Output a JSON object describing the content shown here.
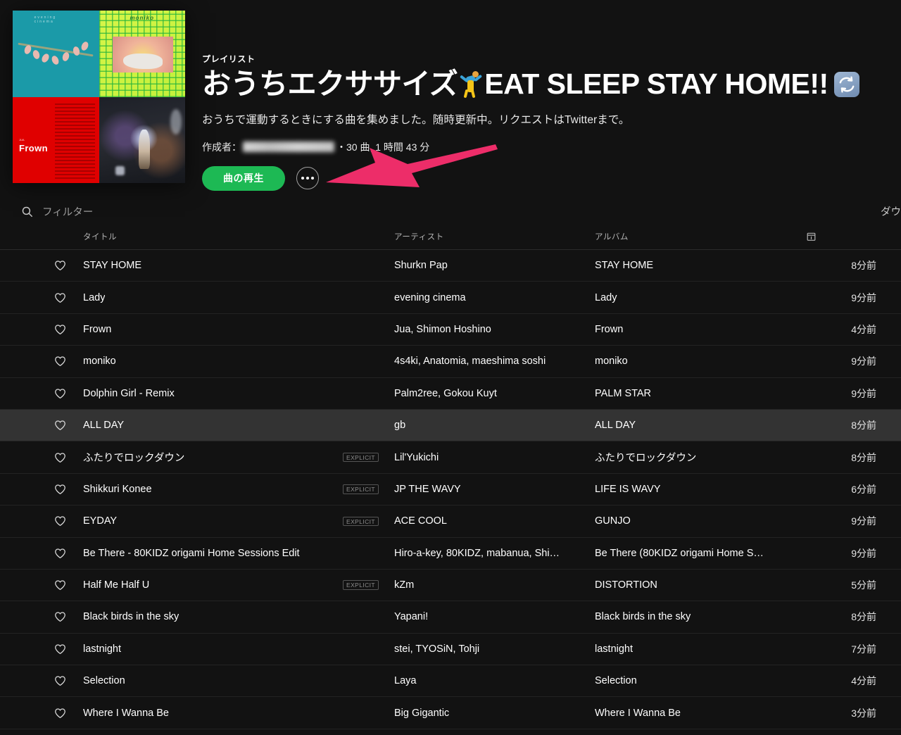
{
  "playlist": {
    "kind_label": "プレイリスト",
    "title_part1": "おうちエクササイズ",
    "title_emoji1": "cartwheel-emoji",
    "title_part2": "EAT SLEEP STAY HOME!!",
    "title_emoji2": "refresh-emoji",
    "title_full": "おうちエクササイズ🤸EAT SLEEP STAY HOME!!🔄",
    "description": "おうちで運動するときにする曲を集めました。随時更新中。リクエストはTwitterまで。",
    "creator_label": "作成者：",
    "creator_name_redacted": "",
    "stats": "・30 曲, 1 時間 43 分",
    "track_count": "30 曲",
    "duration": "1 時間 43 分"
  },
  "actions": {
    "play_label": "曲の再生",
    "more_label": "…",
    "more_icon": "ellipsis-icon"
  },
  "filter": {
    "icon": "search-icon",
    "placeholder": "フィルター",
    "value": ""
  },
  "download": {
    "label": "ダウ"
  },
  "columns": {
    "heart": "",
    "title": "タイトル",
    "artist": "アーティスト",
    "album": "アルバム",
    "date_icon": "calendar-icon"
  },
  "colors": {
    "background": "#121212",
    "accent_green": "#1db954",
    "annotation_pink": "#ED2D69",
    "row_active": "#333333",
    "muted_text": "#b3b3b3"
  },
  "annotation": {
    "type": "arrow",
    "direction": "left",
    "points_at": "more-options-button",
    "color": "#ED2D69"
  },
  "tracks": [
    {
      "heart": "heart-outline-icon",
      "title": "STAY HOME",
      "explicit": false,
      "artist": "Shurkn Pap",
      "album": "STAY HOME",
      "date": "8分前",
      "active": false
    },
    {
      "heart": "heart-outline-icon",
      "title": "Lady",
      "explicit": false,
      "artist": "evening cinema",
      "album": "Lady",
      "date": "9分前",
      "active": false
    },
    {
      "heart": "heart-outline-icon",
      "title": "Frown",
      "explicit": false,
      "artist": "Jua, Shimon Hoshino",
      "album": "Frown",
      "date": "4分前",
      "active": false
    },
    {
      "heart": "heart-outline-icon",
      "title": "moniko",
      "explicit": false,
      "artist": "4s4ki, Anatomia, maeshima soshi",
      "album": "moniko",
      "date": "9分前",
      "active": false
    },
    {
      "heart": "heart-outline-icon",
      "title": "Dolphin Girl - Remix",
      "explicit": false,
      "artist": "Palm2ree, Gokou Kuyt",
      "album": "PALM STAR",
      "date": "9分前",
      "active": false
    },
    {
      "heart": "heart-outline-icon",
      "title": "ALL DAY",
      "explicit": false,
      "artist": "gb",
      "album": "ALL DAY",
      "date": "8分前",
      "active": true
    },
    {
      "heart": "heart-outline-icon",
      "title": "ふたりでロックダウン",
      "explicit": true,
      "artist": "Lil'Yukichi",
      "album": "ふたりでロックダウン",
      "date": "8分前",
      "active": false
    },
    {
      "heart": "heart-outline-icon",
      "title": "Shikkuri Konee",
      "explicit": true,
      "artist": "JP THE WAVY",
      "album": "LIFE IS WAVY",
      "date": "6分前",
      "active": false
    },
    {
      "heart": "heart-outline-icon",
      "title": "EYDAY",
      "explicit": true,
      "artist": "ACE COOL",
      "album": "GUNJO",
      "date": "9分前",
      "active": false
    },
    {
      "heart": "heart-outline-icon",
      "title": "Be There - 80KIDZ origami Home Sessions Edit",
      "explicit": false,
      "artist": "Hiro-a-key, 80KIDZ, mabanua, Shi…",
      "album": "Be There (80KIDZ origami Home S…",
      "date": "9分前",
      "active": false
    },
    {
      "heart": "heart-outline-icon",
      "title": "Half Me Half U",
      "explicit": true,
      "artist": "kZm",
      "album": "DISTORTION",
      "date": "5分前",
      "active": false
    },
    {
      "heart": "heart-outline-icon",
      "title": "Black birds in the sky",
      "explicit": false,
      "artist": "Yapani!",
      "album": "Black birds in the sky",
      "date": "8分前",
      "active": false
    },
    {
      "heart": "heart-outline-icon",
      "title": "lastnight",
      "explicit": false,
      "artist": "stei, TYOSiN, Tohji",
      "album": "lastnight",
      "date": "7分前",
      "active": false
    },
    {
      "heart": "heart-outline-icon",
      "title": "Selection",
      "explicit": false,
      "artist": "Laya",
      "album": "Selection",
      "date": "4分前",
      "active": false
    },
    {
      "heart": "heart-outline-icon",
      "title": "Where I Wanna Be",
      "explicit": false,
      "artist": "Big Gigantic",
      "album": "Where I Wanna Be",
      "date": "3分前",
      "active": false
    }
  ],
  "explicit_badge_label": "EXPLICIT"
}
